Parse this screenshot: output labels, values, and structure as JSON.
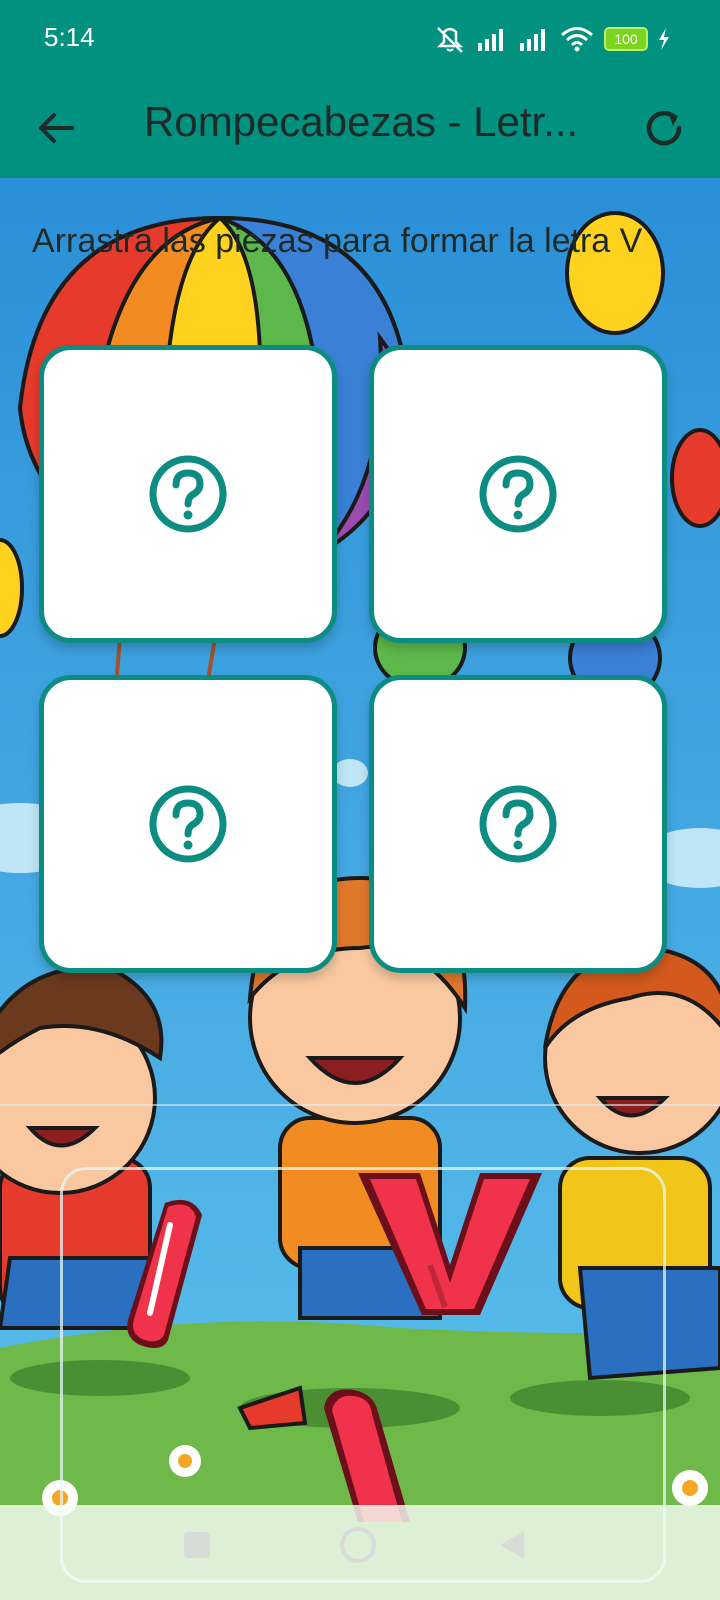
{
  "status_bar": {
    "time": "5:14",
    "battery": "100",
    "icons": [
      "mute-vibrate-icon",
      "signal-icon",
      "signal-icon",
      "wifi-icon",
      "battery-icon",
      "charging-icon"
    ]
  },
  "app_bar": {
    "title": "Rompecabezas - Letr...",
    "back_icon": "arrow-left-icon",
    "refresh_icon": "refresh-icon"
  },
  "instruction": "Arrastra las piezas para formar la letra V",
  "slots": [
    {
      "icon": "question-circle-icon"
    },
    {
      "icon": "question-circle-icon"
    },
    {
      "icon": "question-circle-icon"
    },
    {
      "icon": "question-circle-icon"
    }
  ],
  "pieces": [
    "piece-stroke-left",
    "piece-v",
    "piece-stroke-bottom"
  ],
  "colors": {
    "primary": "#00917f",
    "tile_border": "#0d8c82",
    "piece_red": "#f0334a"
  },
  "nav_bar": {
    "icons": [
      "square-icon",
      "circle-icon",
      "triangle-back-icon"
    ]
  }
}
